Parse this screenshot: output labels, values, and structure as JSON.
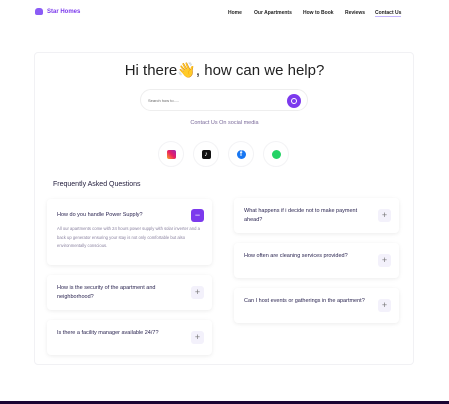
{
  "brand": "Star Homes",
  "nav": [
    "Home",
    "Our Apartments",
    "How to Book",
    "Reviews",
    "Contact Us"
  ],
  "heading": "Hi there👋, how can we help?",
  "search": {
    "placeholder": "Search how to....."
  },
  "contact_label": "Contact Us On social media",
  "social": [
    "instagram",
    "tiktok",
    "facebook",
    "whatsapp"
  ],
  "faq": {
    "title": "Frequently Asked Questions",
    "left": [
      {
        "q": "How do you handle Power Supply?",
        "a": "All our apartments come with 24 hours power supply with solar inverter and a back up generator ensuring your stay is not only comfortable but also environmentally conscious.",
        "toggle": "−"
      },
      {
        "q": "How is the security of the apartment and neighborhood?",
        "toggle": "+"
      },
      {
        "q": "Is there a facility manager available 24/7?",
        "toggle": "+"
      }
    ],
    "right": [
      {
        "q": "What happens if i decide not to make payment ahead?",
        "toggle": "+"
      },
      {
        "q": "How often are cleaning services provided?",
        "toggle": "+"
      },
      {
        "q": "Can I host events or gatherings in the apartment?",
        "toggle": "+"
      }
    ]
  }
}
